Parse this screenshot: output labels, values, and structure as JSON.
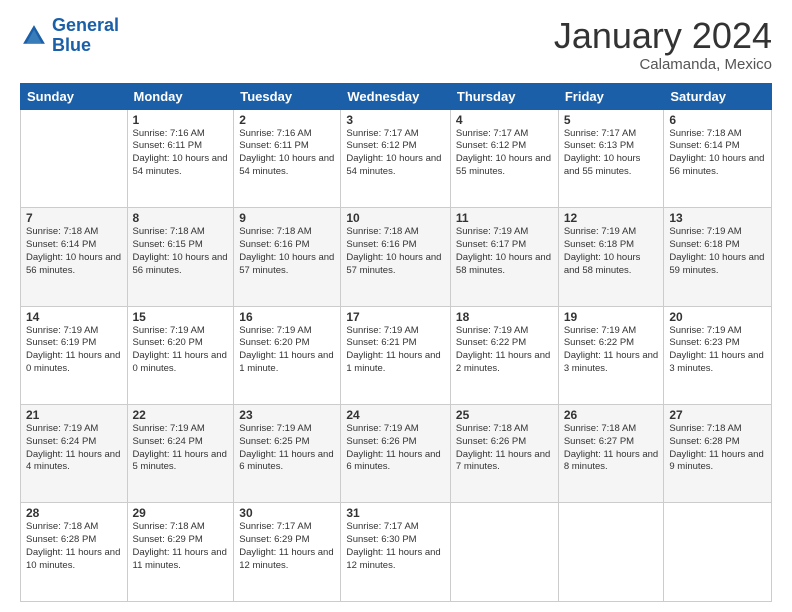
{
  "logo": {
    "line1": "General",
    "line2": "Blue"
  },
  "header": {
    "month": "January 2024",
    "location": "Calamanda, Mexico"
  },
  "weekdays": [
    "Sunday",
    "Monday",
    "Tuesday",
    "Wednesday",
    "Thursday",
    "Friday",
    "Saturday"
  ],
  "weeks": [
    [
      {
        "day": "",
        "sunrise": "",
        "sunset": "",
        "daylight": ""
      },
      {
        "day": "1",
        "sunrise": "7:16 AM",
        "sunset": "6:11 PM",
        "daylight": "10 hours and 54 minutes."
      },
      {
        "day": "2",
        "sunrise": "7:16 AM",
        "sunset": "6:11 PM",
        "daylight": "10 hours and 54 minutes."
      },
      {
        "day": "3",
        "sunrise": "7:17 AM",
        "sunset": "6:12 PM",
        "daylight": "10 hours and 54 minutes."
      },
      {
        "day": "4",
        "sunrise": "7:17 AM",
        "sunset": "6:12 PM",
        "daylight": "10 hours and 55 minutes."
      },
      {
        "day": "5",
        "sunrise": "7:17 AM",
        "sunset": "6:13 PM",
        "daylight": "10 hours and 55 minutes."
      },
      {
        "day": "6",
        "sunrise": "7:18 AM",
        "sunset": "6:14 PM",
        "daylight": "10 hours and 56 minutes."
      }
    ],
    [
      {
        "day": "7",
        "sunrise": "7:18 AM",
        "sunset": "6:14 PM",
        "daylight": "10 hours and 56 minutes."
      },
      {
        "day": "8",
        "sunrise": "7:18 AM",
        "sunset": "6:15 PM",
        "daylight": "10 hours and 56 minutes."
      },
      {
        "day": "9",
        "sunrise": "7:18 AM",
        "sunset": "6:16 PM",
        "daylight": "10 hours and 57 minutes."
      },
      {
        "day": "10",
        "sunrise": "7:18 AM",
        "sunset": "6:16 PM",
        "daylight": "10 hours and 57 minutes."
      },
      {
        "day": "11",
        "sunrise": "7:19 AM",
        "sunset": "6:17 PM",
        "daylight": "10 hours and 58 minutes."
      },
      {
        "day": "12",
        "sunrise": "7:19 AM",
        "sunset": "6:18 PM",
        "daylight": "10 hours and 58 minutes."
      },
      {
        "day": "13",
        "sunrise": "7:19 AM",
        "sunset": "6:18 PM",
        "daylight": "10 hours and 59 minutes."
      }
    ],
    [
      {
        "day": "14",
        "sunrise": "7:19 AM",
        "sunset": "6:19 PM",
        "daylight": "11 hours and 0 minutes."
      },
      {
        "day": "15",
        "sunrise": "7:19 AM",
        "sunset": "6:20 PM",
        "daylight": "11 hours and 0 minutes."
      },
      {
        "day": "16",
        "sunrise": "7:19 AM",
        "sunset": "6:20 PM",
        "daylight": "11 hours and 1 minute."
      },
      {
        "day": "17",
        "sunrise": "7:19 AM",
        "sunset": "6:21 PM",
        "daylight": "11 hours and 1 minute."
      },
      {
        "day": "18",
        "sunrise": "7:19 AM",
        "sunset": "6:22 PM",
        "daylight": "11 hours and 2 minutes."
      },
      {
        "day": "19",
        "sunrise": "7:19 AM",
        "sunset": "6:22 PM",
        "daylight": "11 hours and 3 minutes."
      },
      {
        "day": "20",
        "sunrise": "7:19 AM",
        "sunset": "6:23 PM",
        "daylight": "11 hours and 3 minutes."
      }
    ],
    [
      {
        "day": "21",
        "sunrise": "7:19 AM",
        "sunset": "6:24 PM",
        "daylight": "11 hours and 4 minutes."
      },
      {
        "day": "22",
        "sunrise": "7:19 AM",
        "sunset": "6:24 PM",
        "daylight": "11 hours and 5 minutes."
      },
      {
        "day": "23",
        "sunrise": "7:19 AM",
        "sunset": "6:25 PM",
        "daylight": "11 hours and 6 minutes."
      },
      {
        "day": "24",
        "sunrise": "7:19 AM",
        "sunset": "6:26 PM",
        "daylight": "11 hours and 6 minutes."
      },
      {
        "day": "25",
        "sunrise": "7:18 AM",
        "sunset": "6:26 PM",
        "daylight": "11 hours and 7 minutes."
      },
      {
        "day": "26",
        "sunrise": "7:18 AM",
        "sunset": "6:27 PM",
        "daylight": "11 hours and 8 minutes."
      },
      {
        "day": "27",
        "sunrise": "7:18 AM",
        "sunset": "6:28 PM",
        "daylight": "11 hours and 9 minutes."
      }
    ],
    [
      {
        "day": "28",
        "sunrise": "7:18 AM",
        "sunset": "6:28 PM",
        "daylight": "11 hours and 10 minutes."
      },
      {
        "day": "29",
        "sunrise": "7:18 AM",
        "sunset": "6:29 PM",
        "daylight": "11 hours and 11 minutes."
      },
      {
        "day": "30",
        "sunrise": "7:17 AM",
        "sunset": "6:29 PM",
        "daylight": "11 hours and 12 minutes."
      },
      {
        "day": "31",
        "sunrise": "7:17 AM",
        "sunset": "6:30 PM",
        "daylight": "11 hours and 12 minutes."
      },
      {
        "day": "",
        "sunrise": "",
        "sunset": "",
        "daylight": ""
      },
      {
        "day": "",
        "sunrise": "",
        "sunset": "",
        "daylight": ""
      },
      {
        "day": "",
        "sunrise": "",
        "sunset": "",
        "daylight": ""
      }
    ]
  ],
  "labels": {
    "sunrise": "Sunrise:",
    "sunset": "Sunset:",
    "daylight": "Daylight:"
  }
}
